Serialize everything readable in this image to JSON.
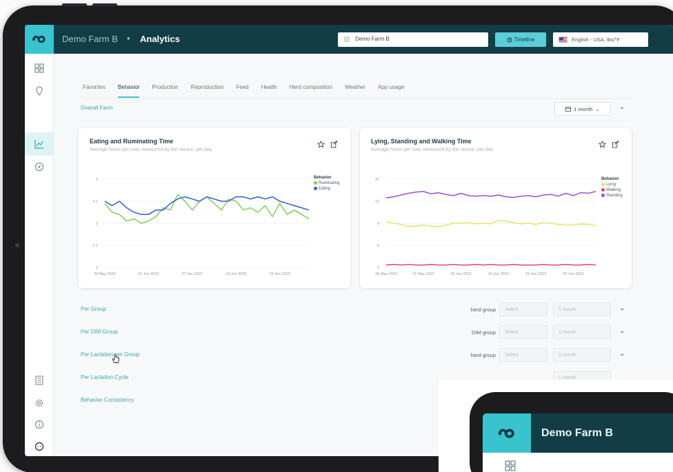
{
  "topbar": {
    "farm": "Demo Farm B",
    "separator": "•",
    "page": "Analytics",
    "farm_select": "Demo Farm B",
    "timeline_label": "Timeline",
    "language_label": "English - USA, lbs/°F"
  },
  "tabs": [
    "Favorites",
    "Behavior",
    "Production",
    "Reproduction",
    "Feed",
    "Health",
    "Herd composition",
    "Weather",
    "App usage"
  ],
  "active_tab": "Behavior",
  "overall_link": "Overall Farm",
  "period": "1 month",
  "cards": [
    {
      "title": "Eating and Ruminating Time",
      "subtitle": "Average hours per cow, measured by the sensor, per day",
      "legend_title": "Behavior",
      "legend": [
        "Ruminating",
        "Eating"
      ]
    },
    {
      "title": "Lying, Standing and Walking Time",
      "subtitle": "Average hours per cow, measured by the sensor, per day",
      "legend_title": "Behavior",
      "legend": [
        "Lying",
        "Walking",
        "Standing"
      ]
    }
  ],
  "chart_data": [
    {
      "type": "line",
      "title": "Eating and Ruminating Time",
      "x": [
        "26 May 2022",
        "27 May",
        "28 May",
        "29 May",
        "30 May",
        "31 May",
        "01 Jun 2022",
        "02 Jun",
        "03 Jun",
        "04 Jun",
        "05 Jun",
        "06 Jun",
        "07 Jun 2022",
        "08 Jun",
        "09 Jun",
        "10 Jun",
        "11 Jun",
        "12 Jun",
        "13 Jun 2022",
        "14 Jun",
        "15 Jun",
        "16 Jun",
        "17 Jun",
        "18 Jun",
        "19 Jun 2022",
        "20 Jun",
        "21 Jun",
        "22 Jun",
        "23 Jun"
      ],
      "tick_labels": [
        "26 May 2022",
        "01 Jun 2022",
        "07 Jun 2022",
        "13 Jun 2022",
        "19 Jun 2022"
      ],
      "y_ticks": [
        "1",
        "2.1",
        "3",
        "4.1",
        "5"
      ],
      "ylim": [
        1,
        5
      ],
      "series": [
        {
          "name": "Ruminating",
          "color": "#7fce5b",
          "values": [
            3.9,
            3.5,
            3.4,
            3.1,
            3.2,
            3.0,
            3.1,
            3.3,
            3.7,
            3.6,
            4.3,
            4.0,
            3.6,
            4.0,
            4.2,
            3.9,
            3.6,
            4.1,
            4.0,
            3.6,
            3.7,
            3.5,
            3.8,
            3.3,
            3.9,
            3.4,
            3.6,
            3.4,
            3.2
          ]
        },
        {
          "name": "Eating",
          "color": "#2f5ec9",
          "values": [
            4.0,
            3.8,
            4.0,
            3.7,
            3.5,
            3.4,
            3.4,
            3.6,
            3.6,
            3.9,
            4.1,
            4.2,
            4.1,
            4.0,
            4.2,
            4.1,
            4.0,
            4.0,
            4.2,
            4.2,
            4.1,
            4.2,
            4.1,
            4.2,
            4.0,
            3.9,
            3.8,
            3.7,
            3.6
          ]
        }
      ]
    },
    {
      "type": "line",
      "title": "Lying, Standing and Walking Time",
      "x": [
        "26 May 2022",
        "27 May",
        "28 May",
        "29 May",
        "30 May",
        "31 May 2022",
        "01 Jun",
        "02 Jun",
        "03 Jun",
        "04 Jun",
        "05 Jun 2022",
        "06 Jun",
        "07 Jun",
        "08 Jun",
        "09 Jun",
        "10 Jun 2022",
        "11 Jun",
        "12 Jun",
        "13 Jun",
        "14 Jun",
        "15 Jun 2022",
        "16 Jun",
        "17 Jun",
        "18 Jun",
        "19 Jun",
        "20 Jun 2022",
        "21 Jun",
        "22 Jun",
        "23 Jun"
      ],
      "tick_labels": [
        "26 May 2022",
        "31 May 2022",
        "05 Jun 2022",
        "10 Jun 2022",
        "15 Jun 2022",
        "20 Jun 2022"
      ],
      "y_ticks": [
        "0",
        "6",
        "9",
        "12",
        "15"
      ],
      "ylim": [
        0,
        15
      ],
      "series": [
        {
          "name": "Lying",
          "color": "#e9e06a",
          "values": [
            7.8,
            7.5,
            7.3,
            7.0,
            7.0,
            7.2,
            7.0,
            6.9,
            7.2,
            7.5,
            7.5,
            7.6,
            7.4,
            7.5,
            7.4,
            8.0,
            7.9,
            7.6,
            7.4,
            7.5,
            7.3,
            7.6,
            7.5,
            7.3,
            7.2,
            7.2,
            7.4,
            7.3,
            7.1
          ]
        },
        {
          "name": "Walking",
          "color": "#d9437a",
          "values": [
            0.4,
            0.5,
            0.4,
            0.5,
            0.4,
            0.4,
            0.5,
            0.4,
            0.4,
            0.5,
            0.4,
            0.4,
            0.5,
            0.4,
            0.5,
            0.4,
            0.4,
            0.5,
            0.4,
            0.4,
            0.4,
            0.5,
            0.4,
            0.4,
            0.5,
            0.4,
            0.4,
            0.5,
            0.4
          ]
        },
        {
          "name": "Standing",
          "color": "#9b4fd1",
          "values": [
            11.8,
            12.0,
            12.3,
            12.6,
            12.8,
            12.9,
            12.5,
            12.7,
            12.4,
            12.2,
            12.6,
            12.2,
            12.1,
            12.2,
            12.1,
            12.3,
            12.0,
            11.9,
            12.1,
            12.2,
            12.0,
            12.3,
            12.4,
            12.1,
            12.6,
            12.2,
            12.7,
            12.6,
            12.9
          ]
        }
      ]
    }
  ],
  "rows": [
    {
      "link": "Per Group",
      "label": "herd group",
      "select": "Select",
      "period": "1 month"
    },
    {
      "link": "Per DIM Group",
      "label": "DIM group",
      "select": "Select",
      "period": "1 month"
    },
    {
      "link": "Per Lactation per Group",
      "label": "herd group",
      "select": "Select",
      "period": "1 month"
    },
    {
      "link": "Per Lactation Cycle",
      "label": "",
      "select": "",
      "period": "1 month"
    },
    {
      "link": "Behavior Consistency",
      "label": "",
      "select": "",
      "period": ""
    }
  ],
  "phone": {
    "title": "Demo Farm B"
  }
}
